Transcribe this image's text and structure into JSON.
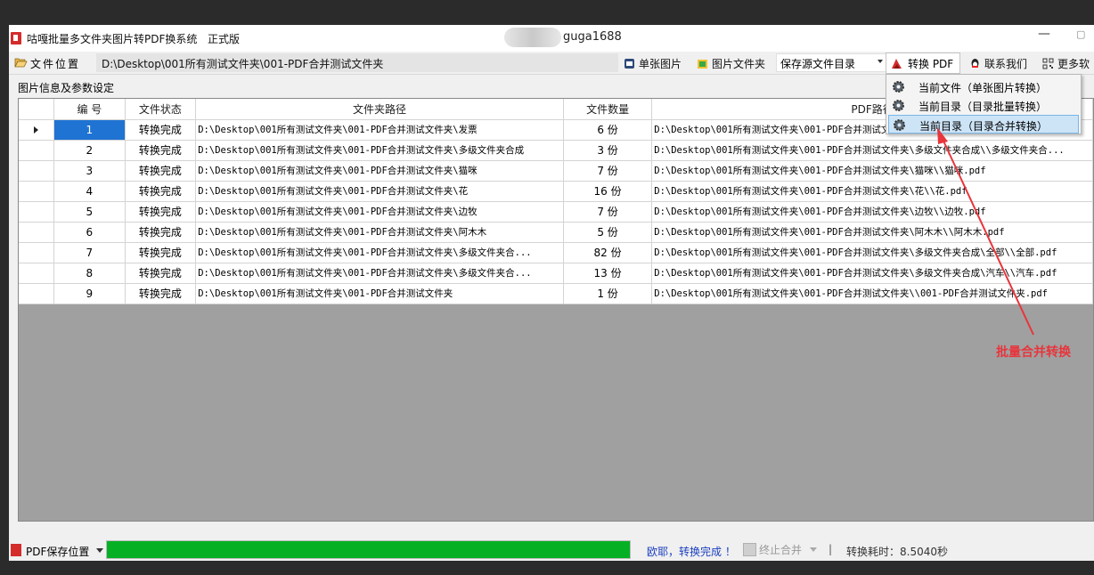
{
  "window": {
    "title": "咕嘎批量多文件夹图片转PDF换系统",
    "edition": "正式版",
    "user": "guga1688",
    "minimize": "—",
    "maximize": "▢"
  },
  "toolbar": {
    "location_label": "文件位置",
    "path": "D:\\Desktop\\001所有测试文件夹\\001-PDF合并测试文件夹",
    "single_image_label": "单张图片",
    "image_folder_label": "图片文件夹",
    "save_combo_value": "保存源文件目录",
    "convert_label": "转换 PDF",
    "contact_label": "联系我们",
    "more_label": "更多软"
  },
  "dropdown": {
    "items": [
      {
        "label": "当前文件（单张图片转换）",
        "icon": "gear-icon"
      },
      {
        "label": "当前目录（目录批量转换）",
        "icon": "gear-icon"
      },
      {
        "label": "当前目录（目录合并转换）",
        "icon": "gear-icon",
        "selected": true
      }
    ]
  },
  "group_label": "图片信息及参数设定",
  "grid": {
    "columns": [
      "编 号",
      "文件状态",
      "文件夹路径",
      "文件数量",
      "PDF路径"
    ],
    "rows": [
      {
        "num": "1",
        "status": "转换完成",
        "folder": "D:\\Desktop\\001所有测试文件夹\\001-PDF合并测试文件夹\\发票",
        "count": "6 份",
        "pdf": "D:\\Desktop\\001所有测试文件夹\\001-PDF合并测试文件夹\\发票\\\\发票.pdf"
      },
      {
        "num": "2",
        "status": "转换完成",
        "folder": "D:\\Desktop\\001所有测试文件夹\\001-PDF合并测试文件夹\\多级文件夹合成",
        "count": "3 份",
        "pdf": "D:\\Desktop\\001所有测试文件夹\\001-PDF合并测试文件夹\\多级文件夹合成\\\\多级文件夹合..."
      },
      {
        "num": "3",
        "status": "转换完成",
        "folder": "D:\\Desktop\\001所有测试文件夹\\001-PDF合并测试文件夹\\猫咪",
        "count": "7 份",
        "pdf": "D:\\Desktop\\001所有测试文件夹\\001-PDF合并测试文件夹\\猫咪\\\\猫咪.pdf"
      },
      {
        "num": "4",
        "status": "转换完成",
        "folder": "D:\\Desktop\\001所有测试文件夹\\001-PDF合并测试文件夹\\花",
        "count": "16 份",
        "pdf": "D:\\Desktop\\001所有测试文件夹\\001-PDF合并测试文件夹\\花\\\\花.pdf"
      },
      {
        "num": "5",
        "status": "转换完成",
        "folder": "D:\\Desktop\\001所有测试文件夹\\001-PDF合并测试文件夹\\边牧",
        "count": "7 份",
        "pdf": "D:\\Desktop\\001所有测试文件夹\\001-PDF合并测试文件夹\\边牧\\\\边牧.pdf"
      },
      {
        "num": "6",
        "status": "转换完成",
        "folder": "D:\\Desktop\\001所有测试文件夹\\001-PDF合并测试文件夹\\阿木木",
        "count": "5 份",
        "pdf": "D:\\Desktop\\001所有测试文件夹\\001-PDF合并测试文件夹\\阿木木\\\\阿木木.pdf"
      },
      {
        "num": "7",
        "status": "转换完成",
        "folder": "D:\\Desktop\\001所有测试文件夹\\001-PDF合并测试文件夹\\多级文件夹合...",
        "count": "82 份",
        "pdf": "D:\\Desktop\\001所有测试文件夹\\001-PDF合并测试文件夹\\多级文件夹合成\\全部\\\\全部.pdf"
      },
      {
        "num": "8",
        "status": "转换完成",
        "folder": "D:\\Desktop\\001所有测试文件夹\\001-PDF合并测试文件夹\\多级文件夹合...",
        "count": "13 份",
        "pdf": "D:\\Desktop\\001所有测试文件夹\\001-PDF合并测试文件夹\\多级文件夹合成\\汽车\\\\汽车.pdf"
      },
      {
        "num": "9",
        "status": "转换完成",
        "folder": "D:\\Desktop\\001所有测试文件夹\\001-PDF合并测试文件夹",
        "count": "1 份",
        "pdf": "D:\\Desktop\\001所有测试文件夹\\001-PDF合并测试文件夹\\\\001-PDF合并测试文件夹.pdf"
      }
    ]
  },
  "statusbar": {
    "save_location_label": "PDF保存位置",
    "progress": 1.0,
    "message": "欧耶，转换完成 ！",
    "stop_label": "终止合并",
    "separator": "|",
    "elapsed": "转换耗时：8.5040秒"
  },
  "annotation": {
    "text": "批量合并转换",
    "color": "#e8353c"
  },
  "colors": {
    "accent_blue": "#1f73d2",
    "progress_green": "#06b025",
    "message_blue": "#1b3fbf"
  }
}
